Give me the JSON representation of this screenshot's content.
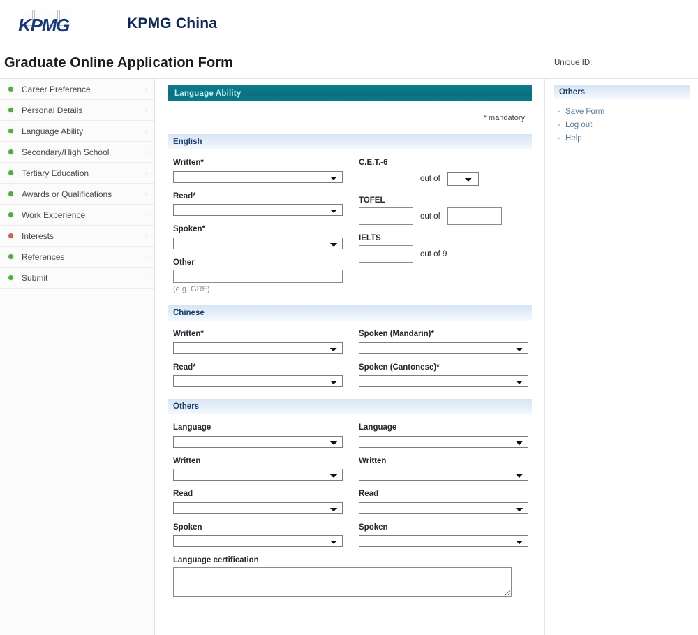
{
  "brand": {
    "logo_text": "KPMG",
    "logo_icon": "kpmg-logo",
    "title": "KPMG China"
  },
  "header": {
    "page_title": "Graduate Online Application Form",
    "unique_id_label": "Unique ID:"
  },
  "sidebar": {
    "items": [
      {
        "label": "Career Preference",
        "bullet": "green"
      },
      {
        "label": "Personal Details",
        "bullet": "green"
      },
      {
        "label": "Language Ability",
        "bullet": "green"
      },
      {
        "label": "Secondary/High School",
        "bullet": "green"
      },
      {
        "label": "Tertiary Education",
        "bullet": "green"
      },
      {
        "label": "Awards or Qualifications",
        "bullet": "green"
      },
      {
        "label": "Work Experience",
        "bullet": "green"
      },
      {
        "label": "Interests",
        "bullet": "red"
      },
      {
        "label": "References",
        "bullet": "green"
      },
      {
        "label": "Submit",
        "bullet": "green"
      }
    ],
    "chevron": "›"
  },
  "panel": {
    "title": "Language Ability",
    "mandatory_note": "* mandatory"
  },
  "sections": {
    "english": {
      "heading": "English",
      "written_label": "Written*",
      "read_label": "Read*",
      "spoken_label": "Spoken*",
      "other_label": "Other",
      "other_hint": "(e.g. GRE)",
      "other_value": "",
      "cet_label": "C.E.T.-6",
      "cet_value": "",
      "cet_outof_label": "out of",
      "cet_outof_value": "",
      "tofel_label": "TOFEL",
      "tofel_value": "",
      "tofel_outof_label": "out of",
      "tofel_outof_value": "",
      "ielts_label": "IELTS",
      "ielts_value": "",
      "ielts_outof_label": "out of 9",
      "written_value": "",
      "read_value": "",
      "spoken_value": ""
    },
    "chinese": {
      "heading": "Chinese",
      "written_label": "Written*",
      "read_label": "Read*",
      "spoken_mandarin_label": "Spoken (Mandarin)*",
      "spoken_cantonese_label": "Spoken (Cantonese)*",
      "written_value": "",
      "read_value": "",
      "spoken_mandarin_value": "",
      "spoken_cantonese_value": ""
    },
    "others": {
      "heading": "Others",
      "language_label": "Language",
      "written_label": "Written",
      "read_label": "Read",
      "spoken_label": "Spoken",
      "certification_label": "Language certification",
      "certification_value": "",
      "col1": {
        "language_value": "",
        "written_value": "",
        "read_value": "",
        "spoken_value": ""
      },
      "col2": {
        "language_value": "",
        "written_value": "",
        "read_value": "",
        "spoken_value": ""
      }
    }
  },
  "right_panel": {
    "heading": "Others",
    "links": [
      {
        "label": "Save Form"
      },
      {
        "label": "Log out"
      },
      {
        "label": "Help"
      }
    ],
    "chevron": "▸"
  },
  "select_options": [
    ""
  ],
  "colors": {
    "panel_header_teal": "#0b7b8a",
    "section_header_blue": "#dbe7f5",
    "bullet_green": "#58a84a",
    "bullet_red": "#c26a59",
    "logo_blue": "#1b3a72",
    "link_blue": "#5b7a93"
  }
}
